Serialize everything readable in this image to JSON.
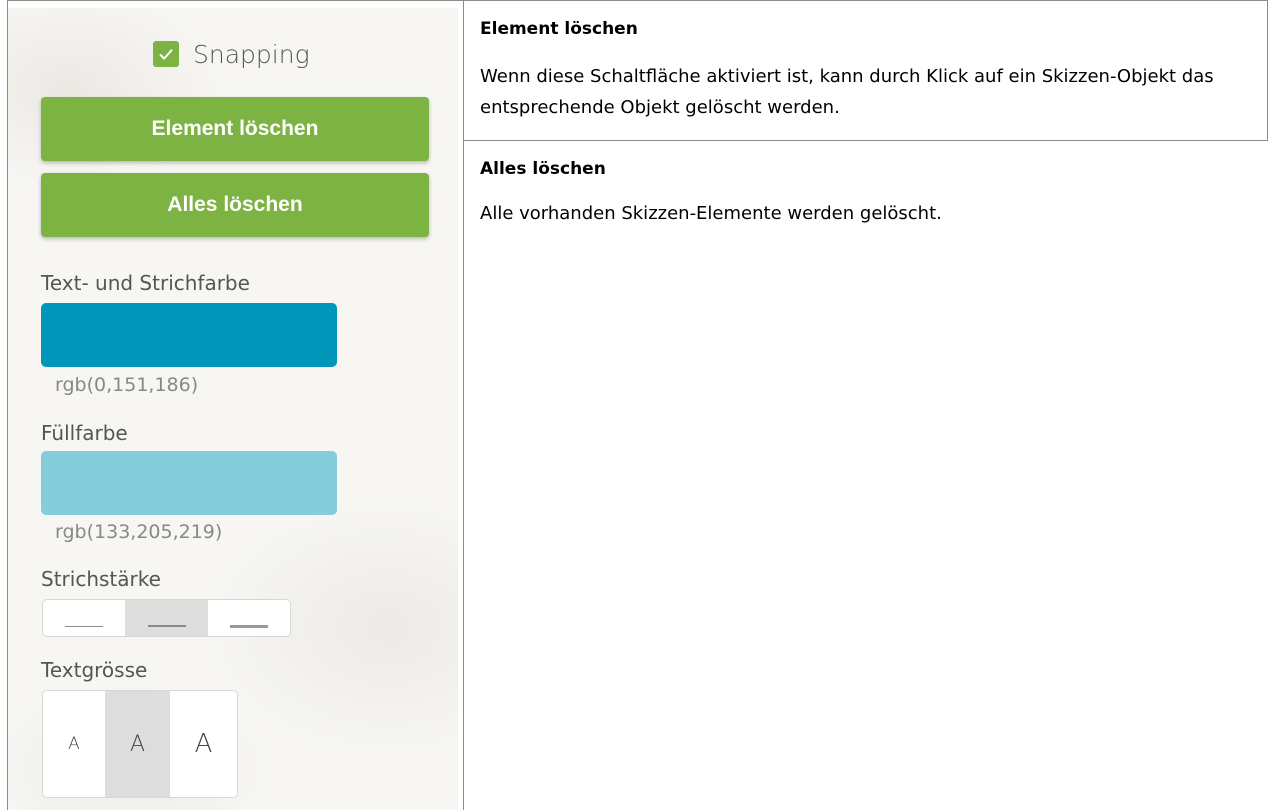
{
  "panel": {
    "snapping_label": "Snapping",
    "snapping_checked": true,
    "delete_element_button": "Element löschen",
    "delete_all_button": "Alles löschen",
    "stroke_color_label": "Text- und Strichfarbe",
    "stroke_color_value": "rgb(0,151,186)",
    "stroke_color_hex": "#0097ba",
    "fill_color_label": "Füllfarbe",
    "fill_color_value": "rgb(133,205,219)",
    "fill_color_hex": "#85cddb",
    "stroke_width_label": "Strichstärke",
    "stroke_width_selected": "medium",
    "text_size_label": "Textgrösse",
    "text_size_options": [
      "A",
      "A",
      "A"
    ],
    "text_size_selected": "medium",
    "accent_color": "#7db343"
  },
  "docs": {
    "sections": [
      {
        "title": "Element löschen",
        "text": "Wenn diese Schaltfläche aktiviert ist, kann durch Klick auf ein Skizzen-Objekt das entsprechende Objekt gelöscht werden."
      },
      {
        "title": "Alles löschen",
        "text": "Alle vorhanden Skizzen-Elemente werden gelöscht."
      }
    ]
  }
}
